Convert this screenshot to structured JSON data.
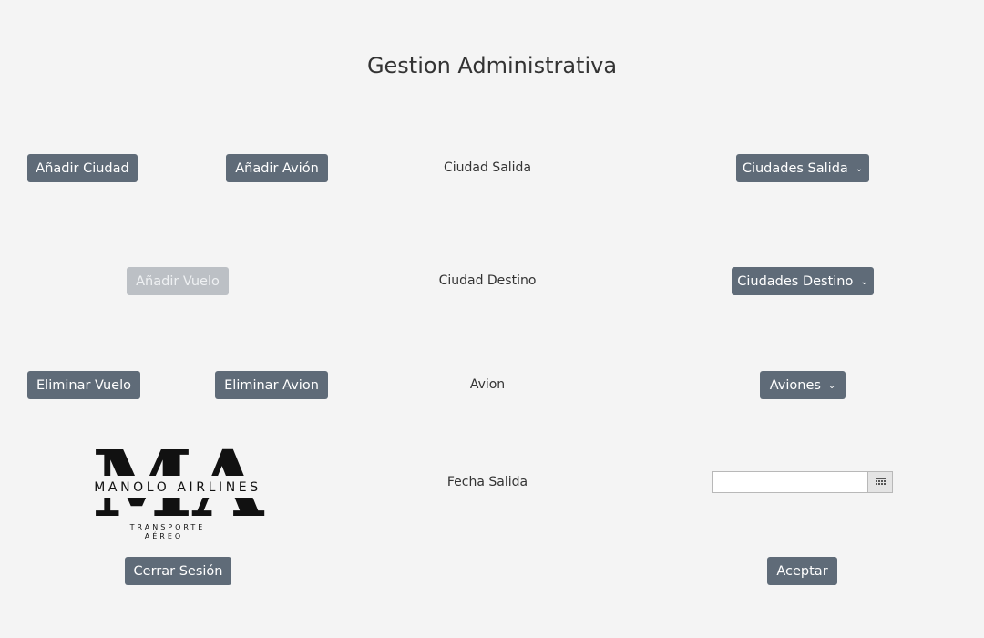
{
  "header": {
    "title": "Gestion Administrativa"
  },
  "actions": {
    "add_city": "Añadir Ciudad",
    "add_plane": "Añadir Avión",
    "add_flight": "Añadir Vuelo",
    "delete_flight": "Eliminar Vuelo",
    "delete_plane": "Eliminar Avion",
    "logout": "Cerrar Sesión",
    "accept": "Aceptar"
  },
  "form": {
    "departure_city_label": "Ciudad Salida",
    "destination_city_label": "Ciudad Destino",
    "plane_label": "Avion",
    "departure_date_label": "Fecha Salida",
    "departure_city_combo": "Ciudades Salida",
    "destination_city_combo": "Ciudades Destino",
    "plane_combo": "Aviones",
    "departure_date_value": ""
  },
  "logo": {
    "monogram": "MA",
    "name": "MANOLO AIRLINES",
    "tagline_1": "TRANSPORTE",
    "tagline_2": "AÉREO"
  },
  "icons": {
    "dropdown": "chevron-down-icon",
    "date_picker": "calendar-icon"
  },
  "colors": {
    "background": "#f4f4f4",
    "button": "#5f6b78",
    "button_disabled": "#bcc0c5",
    "text": "#333333"
  }
}
